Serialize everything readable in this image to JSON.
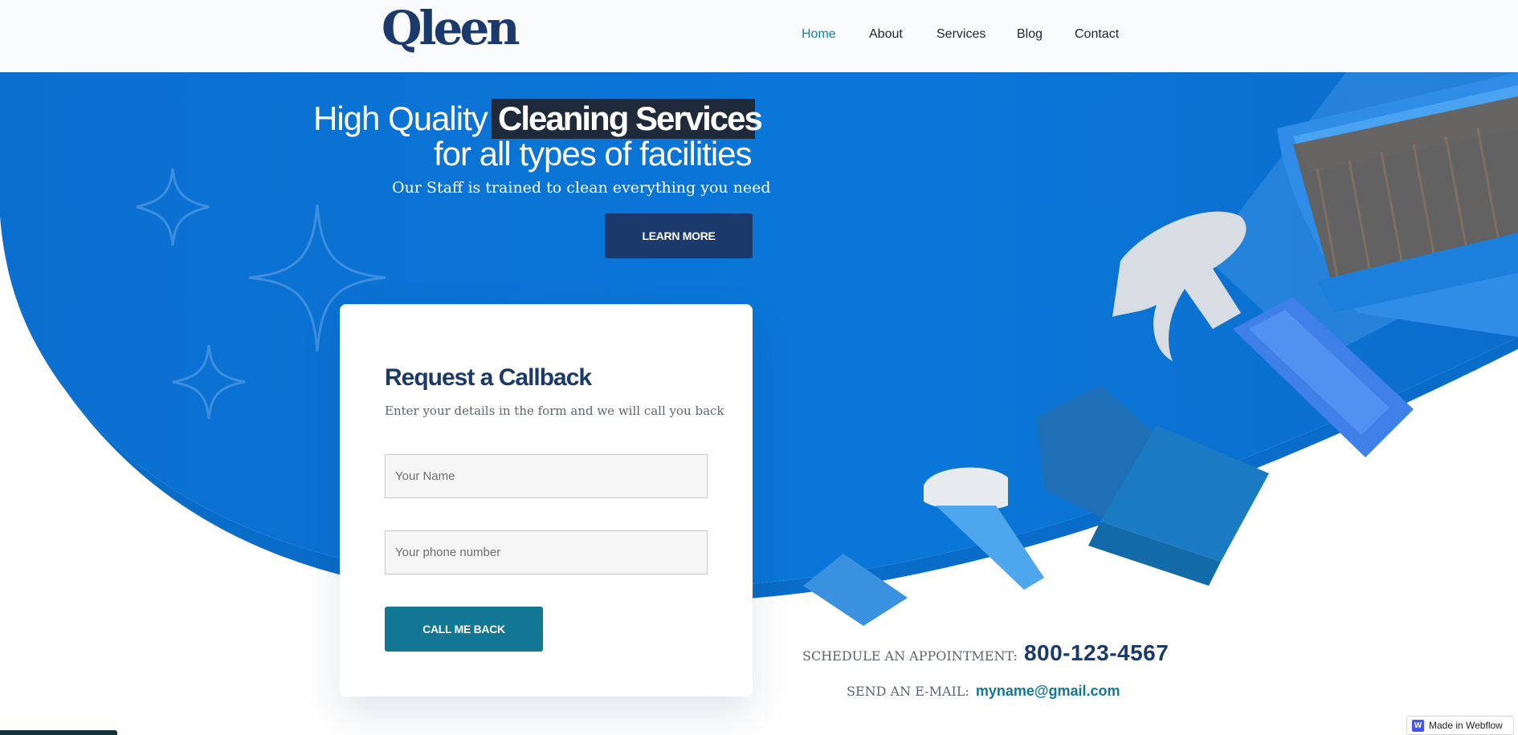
{
  "header": {
    "logo": "Qleen",
    "nav": [
      {
        "label": "Home",
        "active": true
      },
      {
        "label": "About",
        "active": false
      },
      {
        "label": "Services",
        "active": false
      },
      {
        "label": "Blog",
        "active": false
      },
      {
        "label": "Contact",
        "active": false
      }
    ]
  },
  "hero": {
    "title_prefix": "High Quality",
    "title_highlight": "Cleaning Services",
    "title_line2": "for all types of facilities",
    "subtitle": "Our Staff is trained to clean everything you need",
    "cta_label": "LEARN MORE"
  },
  "callback_form": {
    "title": "Request a Callback",
    "subtitle": "Enter your details in the form and we will call you back",
    "name_placeholder": "Your Name",
    "phone_placeholder": "Your phone number",
    "submit_label": "CALL ME BACK"
  },
  "contact": {
    "appointment_label": "SCHEDULE AN APPOINTMENT:",
    "phone": "800-123-4567",
    "email_label": "SEND AN E-MAIL:",
    "email": "myname@gmail.com"
  },
  "badge": {
    "label": "Made in Webflow",
    "icon": "webflow-logo-icon"
  },
  "colors": {
    "hero_blue": "#0a74d4",
    "navy": "#1b3a6b",
    "teal": "#117795",
    "nav_active": "#16839a",
    "highlight_bg": "#1e2a3a",
    "header_bg": "#f8fafc"
  },
  "decor": {
    "sparkle_icons": [
      "sparkle-icon",
      "sparkle-icon",
      "sparkle-icon"
    ],
    "illustration": "cleaning-supplies-illustration"
  }
}
